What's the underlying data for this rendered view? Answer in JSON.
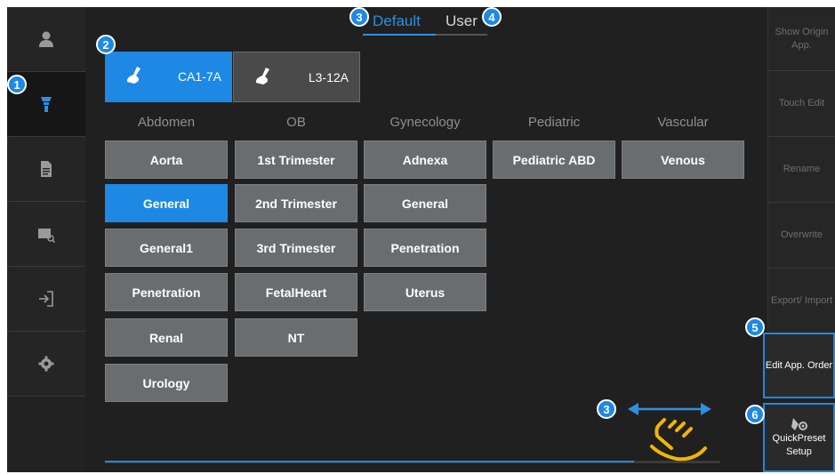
{
  "tabs": [
    {
      "label": "Default",
      "active": true
    },
    {
      "label": "User",
      "active": false
    }
  ],
  "probes": [
    {
      "label": "CA1-7A",
      "selected": true,
      "icon": "probe-icon"
    },
    {
      "label": "L3-12A",
      "selected": false,
      "icon": "probe-icon"
    }
  ],
  "categories": [
    {
      "name": "Abdomen",
      "presets": [
        "Aorta",
        "General",
        "General1",
        "Penetration",
        "Renal",
        "Urology"
      ],
      "selected": "General"
    },
    {
      "name": "OB",
      "presets": [
        "1st Trimester",
        "2nd Trimester",
        "3rd Trimester",
        "FetalHeart",
        "NT"
      ]
    },
    {
      "name": "Gynecology",
      "presets": [
        "Adnexa",
        "General",
        "Penetration",
        "Uterus"
      ]
    },
    {
      "name": "Pediatric",
      "presets": [
        "Pediatric ABD"
      ]
    },
    {
      "name": "Vascular",
      "presets": [
        "Venous"
      ]
    }
  ],
  "sidebar": {
    "items": [
      {
        "icon": "user-icon",
        "active": false
      },
      {
        "icon": "probe-icon",
        "active": true
      },
      {
        "icon": "document-icon",
        "active": false
      },
      {
        "icon": "image-search-icon",
        "active": false
      },
      {
        "icon": "exit-icon",
        "active": false
      },
      {
        "icon": "gear-icon",
        "active": false
      }
    ]
  },
  "right_panel": {
    "show_origin": "Show Origin App.",
    "touch_edit": "Touch Edit",
    "rename": "Rename",
    "overwrite": "Overwrite",
    "export_import": "Export/ Import",
    "edit_app_order": "Edit App. Order",
    "quickpreset": "QuickPreset Setup"
  },
  "callouts": {
    "c1": "1",
    "c2": "2",
    "c3": "3",
    "c4": "4",
    "c5": "5",
    "c6": "6",
    "c3b": "3"
  },
  "colors": {
    "accent": "#1e88e5",
    "gesture": "#f2b600"
  }
}
